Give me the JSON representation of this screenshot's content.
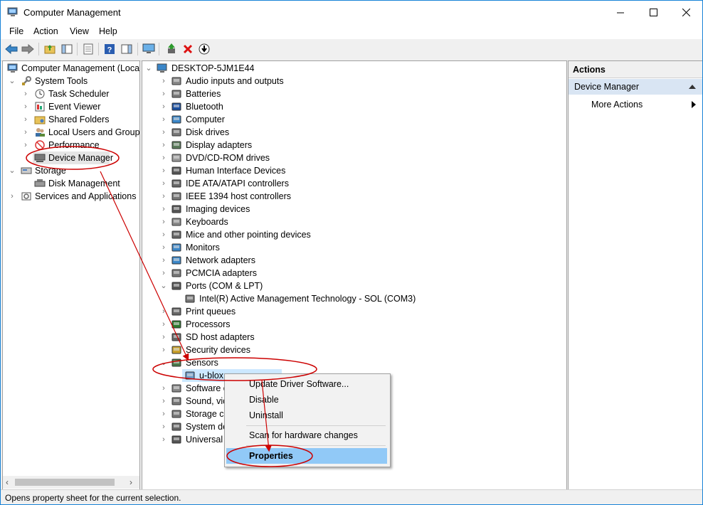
{
  "window": {
    "title": "Computer Management",
    "controls": {
      "minimize": "minimize-icon",
      "maximize": "maximize-icon",
      "close": "close-icon"
    }
  },
  "menubar": {
    "items": [
      "File",
      "Action",
      "View",
      "Help"
    ]
  },
  "toolbar": {
    "icons": [
      "back-icon",
      "forward-icon",
      "up-folder-icon",
      "show-hide-tree-icon",
      "properties-icon",
      "help-icon",
      "action-pane-icon",
      "computer-monitor-icon",
      "update-driver-icon",
      "uninstall-icon",
      "scan-download-icon"
    ]
  },
  "left_tree": {
    "root": "Computer Management (Local",
    "items": [
      {
        "label": "System Tools"
      },
      {
        "label": "Task Scheduler"
      },
      {
        "label": "Event Viewer"
      },
      {
        "label": "Shared Folders"
      },
      {
        "label": "Local Users and Groups"
      },
      {
        "label": "Performance"
      },
      {
        "label": "Device Manager"
      },
      {
        "label": "Storage"
      },
      {
        "label": "Disk Management"
      },
      {
        "label": "Services and Applications"
      }
    ]
  },
  "device_tree": {
    "root": "DESKTOP-5JM1E44",
    "items": [
      {
        "label": "Audio inputs and outputs"
      },
      {
        "label": "Batteries"
      },
      {
        "label": "Bluetooth"
      },
      {
        "label": "Computer"
      },
      {
        "label": "Disk drives"
      },
      {
        "label": "Display adapters"
      },
      {
        "label": "DVD/CD-ROM drives"
      },
      {
        "label": "Human Interface Devices"
      },
      {
        "label": "IDE ATA/ATAPI controllers"
      },
      {
        "label": "IEEE 1394 host controllers"
      },
      {
        "label": "Imaging devices"
      },
      {
        "label": "Keyboards"
      },
      {
        "label": "Mice and other pointing devices"
      },
      {
        "label": "Monitors"
      },
      {
        "label": "Network adapters"
      },
      {
        "label": "PCMCIA adapters"
      },
      {
        "label": "Ports (COM & LPT)"
      },
      {
        "label": "Intel(R) Active Management Technology - SOL (COM3)"
      },
      {
        "label": "Print queues"
      },
      {
        "label": "Processors"
      },
      {
        "label": "SD host adapters"
      },
      {
        "label": "Security devices"
      },
      {
        "label": "Sensors"
      },
      {
        "label": "u-blox"
      },
      {
        "label": "Software c"
      },
      {
        "label": "Sound, vic"
      },
      {
        "label": "Storage co"
      },
      {
        "label": "System de"
      },
      {
        "label": "Universal S"
      }
    ]
  },
  "context_menu": {
    "items": [
      "Update Driver Software...",
      "Disable",
      "Uninstall",
      "Scan for hardware changes",
      "Properties"
    ]
  },
  "actions_pane": {
    "header": "Actions",
    "section": "Device Manager",
    "more_actions": "More Actions"
  },
  "statusbar": {
    "text": "Opens property sheet for the current selection."
  },
  "colors": {
    "selection": "#cce8ff",
    "context_highlight": "#91c9f7",
    "annotation": "#cc0000",
    "section_bg": "#d9e5f3"
  }
}
